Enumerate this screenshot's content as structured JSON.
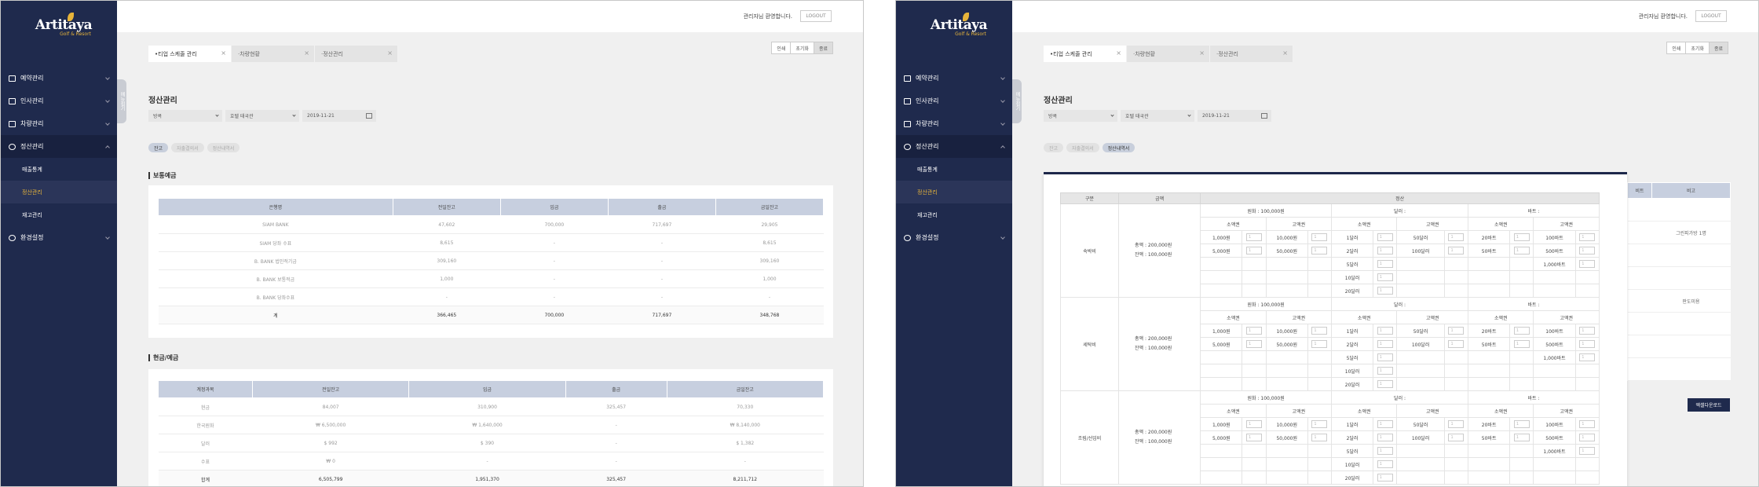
{
  "app": {
    "logo_text": "Artitaya",
    "logo_sub": "Golf & Resort",
    "welcome": "관리자님 환영합니다.",
    "logout_label": "LOGOUT",
    "fold_label": "메뉴접기"
  },
  "sidebar": {
    "items": [
      {
        "label": "예약관리",
        "icon": "calendar-icon"
      },
      {
        "label": "인사관리",
        "icon": "people-icon"
      },
      {
        "label": "차량관리",
        "icon": "car-icon"
      },
      {
        "label": "정산관리",
        "icon": "settlement-icon"
      },
      {
        "label": "환경설정",
        "icon": "gear-icon"
      }
    ],
    "sub_items": [
      "매출통계",
      "정산관리",
      "재고관리"
    ]
  },
  "tabs": [
    "티업 스케줄 관리",
    "차량현황",
    "정산관리"
  ],
  "toolbar": {
    "print": "인쇄",
    "reset": "초기화",
    "close": "종료"
  },
  "page": {
    "title": "정산관리",
    "filter_branch": "방콕",
    "filter_place": "호텔 태국관",
    "filter_date": "2019-11-21",
    "pills": [
      "잔고",
      "자출결의서",
      "정산내역서"
    ]
  },
  "screen_a": {
    "section1_title": "보통예금",
    "table1": {
      "headers": [
        "은행명",
        "전일잔고",
        "입금",
        "출금",
        "금일잔고"
      ],
      "rows": [
        [
          "SIAM BANK",
          "47,602",
          "700,000",
          "717,697",
          "29,905"
        ],
        [
          "SIAM 당좌 수표",
          "8,615",
          "-",
          "-",
          "8,615"
        ],
        [
          "B. BANK 법인적기금",
          "309,160",
          "-",
          "-",
          "309,160"
        ],
        [
          "B. BANK 보통적금",
          "1,000",
          "-",
          "-",
          "1,000"
        ],
        [
          "B. BANK 당좌수표",
          "-",
          "-",
          "-",
          "-"
        ]
      ],
      "total": [
        "계",
        "366,465",
        "700,000",
        "717,697",
        "348,768"
      ]
    },
    "section2_title": "현금/예금",
    "table2": {
      "headers": [
        "계정과목",
        "전일잔고",
        "입금",
        "출금",
        "금일잔고"
      ],
      "rows": [
        [
          "현금",
          "84,007",
          "310,900",
          "325,457",
          "70,330"
        ],
        [
          "한국원화",
          "₩ 6,500,000",
          "₩ 1,640,000",
          "-",
          "₩ 8,140,000"
        ],
        [
          "달러",
          "$ 992",
          "$ 390",
          "-",
          "$ 1,382"
        ],
        [
          "수표",
          "₩ 0",
          "-",
          "-",
          "-"
        ]
      ],
      "total": [
        "합계",
        "6,505,799",
        "1,951,370",
        "325,457",
        "8,211,712"
      ]
    }
  },
  "screen_b": {
    "headers": [
      "구분",
      "금액",
      "정산"
    ],
    "won_label": "원화 : 100,000원",
    "dollar_label": "달러 :",
    "baht_label": "바트 :",
    "col_small": "소액권",
    "col_large": "고액권",
    "amount_total": "총액 : 200,000원",
    "amount_rest": "잔액 : 100,000원",
    "won_small": [
      "1,000원",
      "5,000원"
    ],
    "won_large": [
      "10,000원",
      "50,000원"
    ],
    "dollar_small": [
      "1달러",
      "2달러",
      "5달러",
      "10달러",
      "20달러"
    ],
    "dollar_large": [
      "50달러",
      "100달러"
    ],
    "baht_small": [
      "20바트",
      "50바트"
    ],
    "baht_large": [
      "100바트",
      "500바트",
      "1,000바트"
    ],
    "categories": [
      "숙박비",
      "세탁비",
      "조림/선임비"
    ],
    "input_placeholder": "1",
    "right_headers": [
      "비트",
      "비고"
    ],
    "right_notes": [
      "",
      "그린피가방 1명",
      "",
      "",
      "판도미용",
      "",
      "",
      ""
    ],
    "excel_button": "엑셀다운로드"
  }
}
